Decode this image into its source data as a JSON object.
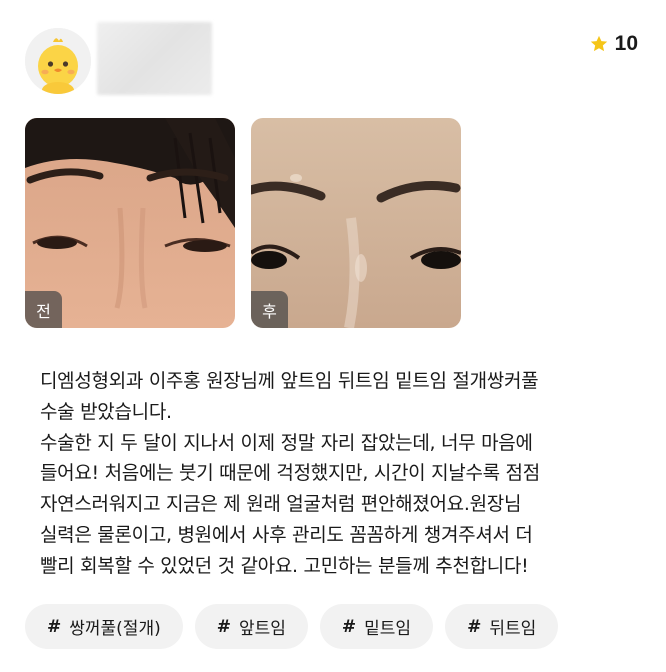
{
  "author": {
    "avatar_icon": "chick-avatar-icon",
    "name_blurred": true
  },
  "rating": {
    "icon": "star-icon",
    "star_color": "#f5c518",
    "score": "10"
  },
  "photos": [
    {
      "label": "전"
    },
    {
      "label": "후"
    }
  ],
  "review": {
    "text": "디엠성형외과 이주홍 원장님께 앞트임 뒤트임 밑트임 절개쌍커풀\n수술 받았습니다.\n수술한 지 두 달이 지나서 이제 정말 자리 잡았는데, 너무 마음에\n들어요! 처음에는 붓기 때문에 걱정했지만, 시간이 지날수록 점점\n자연스러워지고 지금은 제 원래 얼굴처럼 편안해졌어요.원장님\n실력은 물론이고, 병원에서 사후 관리도 꼼꼼하게 챙겨주셔서 더\n빨리 회복할 수 있었던 것 같아요. 고민하는 분들께 추천합니다!"
  },
  "hashtags": [
    {
      "hash": "#",
      "label": "쌍꺼풀(절개)"
    },
    {
      "hash": "#",
      "label": "앞트임"
    },
    {
      "hash": "#",
      "label": "밑트임"
    },
    {
      "hash": "#",
      "label": "뒤트임"
    }
  ]
}
